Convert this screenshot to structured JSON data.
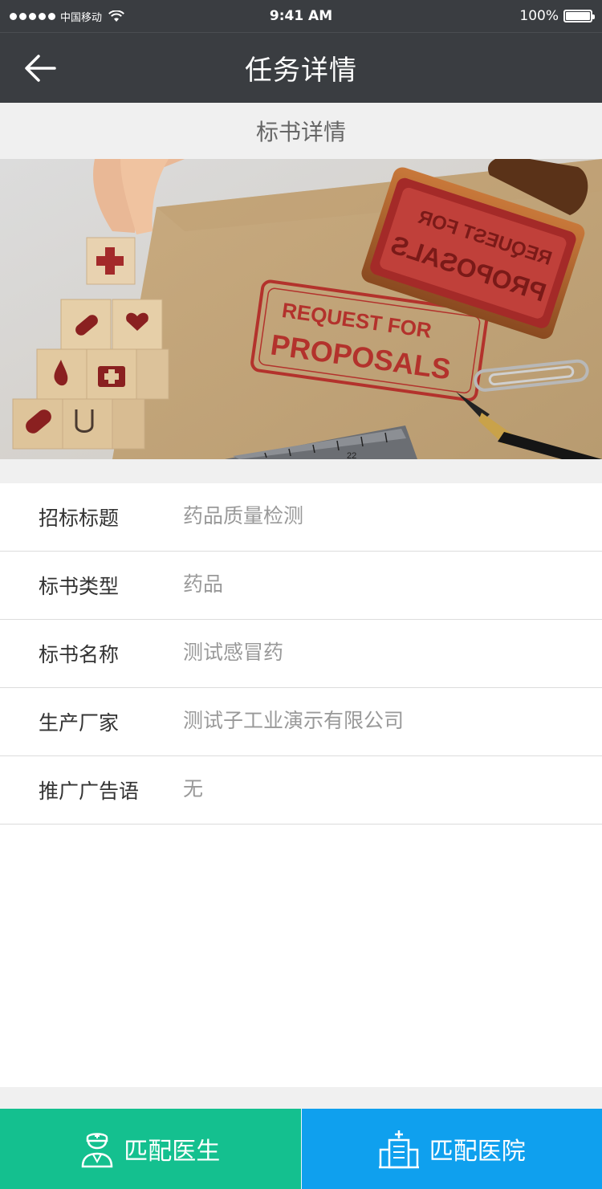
{
  "status_bar": {
    "carrier": "中国移动",
    "time": "9:41 AM",
    "battery": "100%"
  },
  "nav": {
    "title": "任务详情"
  },
  "section": {
    "title": "标书详情"
  },
  "banner": {
    "stamp_text_line1": "REQUEST FOR",
    "stamp_text_line2": "PROPOSALS",
    "stamp_mirror_line1": "REQUEST FOR",
    "stamp_mirror_line2": "PROPOSALS",
    "ruler_number": "22"
  },
  "details": [
    {
      "label": "招标标题",
      "value": "药品质量检测"
    },
    {
      "label": "标书类型",
      "value": "药品"
    },
    {
      "label": "标书名称",
      "value": "测试感冒药"
    },
    {
      "label": "生产厂家",
      "value": "测试子工业演示有限公司"
    },
    {
      "label": "推广广告语",
      "value": "无"
    }
  ],
  "actions": {
    "match_doctor": "匹配医生",
    "match_hospital": "匹配医院"
  },
  "colors": {
    "nav_bg": "#3a3d41",
    "doctor_btn": "#14c08f",
    "hospital_btn": "#0fa0ee"
  }
}
